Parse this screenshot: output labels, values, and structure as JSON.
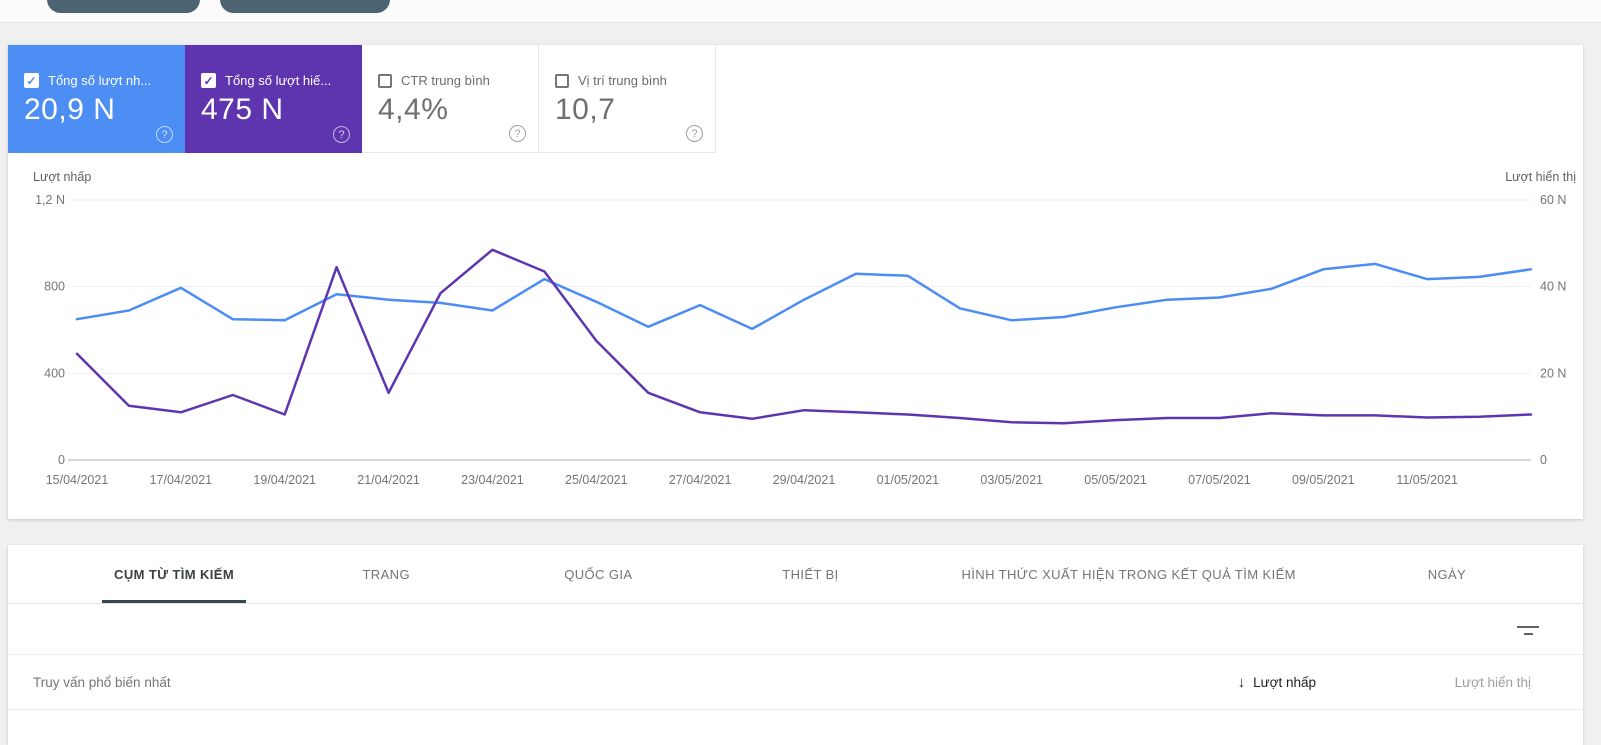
{
  "colors": {
    "clicks_blue": "#4d8ef4",
    "impressions_purple": "#5e34af",
    "chart_blue_line": "#4c8df5",
    "chart_purple_line": "#5e35b1",
    "pill_slate": "#4c6472"
  },
  "metrics": {
    "cards": [
      {
        "label": "Tổng số lượt nh...",
        "value": "20,9 N",
        "checked": true
      },
      {
        "label": "Tổng số lượt hiế...",
        "value": "475 N",
        "checked": true
      },
      {
        "label": "CTR trung bình",
        "value": "4,4%",
        "checked": false
      },
      {
        "label": "Vị trí trung bình",
        "value": "10,7",
        "checked": false
      }
    ]
  },
  "chart_data": {
    "type": "line",
    "x": [
      "15/04/2021",
      "16/04/2021",
      "17/04/2021",
      "18/04/2021",
      "19/04/2021",
      "20/04/2021",
      "21/04/2021",
      "22/04/2021",
      "23/04/2021",
      "24/04/2021",
      "25/04/2021",
      "26/04/2021",
      "27/04/2021",
      "28/04/2021",
      "29/04/2021",
      "30/04/2021",
      "01/05/2021",
      "02/05/2021",
      "03/05/2021",
      "04/05/2021",
      "05/05/2021",
      "06/05/2021",
      "07/05/2021",
      "08/05/2021",
      "09/05/2021",
      "10/05/2021",
      "11/05/2021",
      "12/05/2021",
      "13/05/2021"
    ],
    "x_tick_labels": [
      "15/04/2021",
      "17/04/2021",
      "19/04/2021",
      "21/04/2021",
      "23/04/2021",
      "25/04/2021",
      "27/04/2021",
      "29/04/2021",
      "01/05/2021",
      "03/05/2021",
      "05/05/2021",
      "07/05/2021",
      "09/05/2021",
      "11/05/2021"
    ],
    "series": [
      {
        "name": "Lượt nhấp",
        "axis": "left",
        "color": "#4c8df5",
        "values": [
          650,
          690,
          795,
          650,
          645,
          765,
          740,
          725,
          690,
          835,
          730,
          615,
          715,
          605,
          740,
          860,
          850,
          700,
          645,
          660,
          705,
          740,
          750,
          790,
          880,
          905,
          835,
          845,
          880
        ]
      },
      {
        "name": "Lượt hiển thị",
        "axis": "right",
        "color": "#5e35b1",
        "values": [
          24.5,
          12.5,
          11,
          15,
          10.5,
          44.5,
          15.5,
          38.5,
          48.5,
          43.5,
          27.5,
          15.5,
          11,
          9.5,
          11.5,
          11,
          10.5,
          9.7,
          8.7,
          8.5,
          9.2,
          9.7,
          9.7,
          10.8,
          10.3,
          10.3,
          9.8,
          10,
          10.5
        ]
      }
    ],
    "left_axis": {
      "title": "Lượt nhấp",
      "ticks": [
        "1,2 N",
        "800",
        "400",
        "0"
      ],
      "max": 1200
    },
    "right_axis": {
      "title": "Lượt hiển thị",
      "ticks": [
        "60 N",
        "40 N",
        "20 N",
        "0"
      ],
      "max": 60
    },
    "grid": "horizontal-only",
    "legend": "none"
  },
  "tabs": {
    "items": [
      {
        "label": "CỤM TỪ TÌM KIẾM",
        "active": true
      },
      {
        "label": "TRANG",
        "active": false
      },
      {
        "label": "QUỐC GIA",
        "active": false
      },
      {
        "label": "THIẾT BỊ",
        "active": false
      },
      {
        "label": "HÌNH THỨC XUẤT HIỆN TRONG KẾT QUẢ TÌM KIẾM",
        "active": false
      },
      {
        "label": "NGÀY",
        "active": false
      }
    ]
  },
  "table": {
    "first_column_header": "Truy vấn phổ biến nhất",
    "sort_column_header": "Lượt nhấp",
    "sort_arrow": "↓",
    "second_column_header": "Lượt hiển thị"
  },
  "help_icon_glyph": "?",
  "check_glyph": "✓"
}
